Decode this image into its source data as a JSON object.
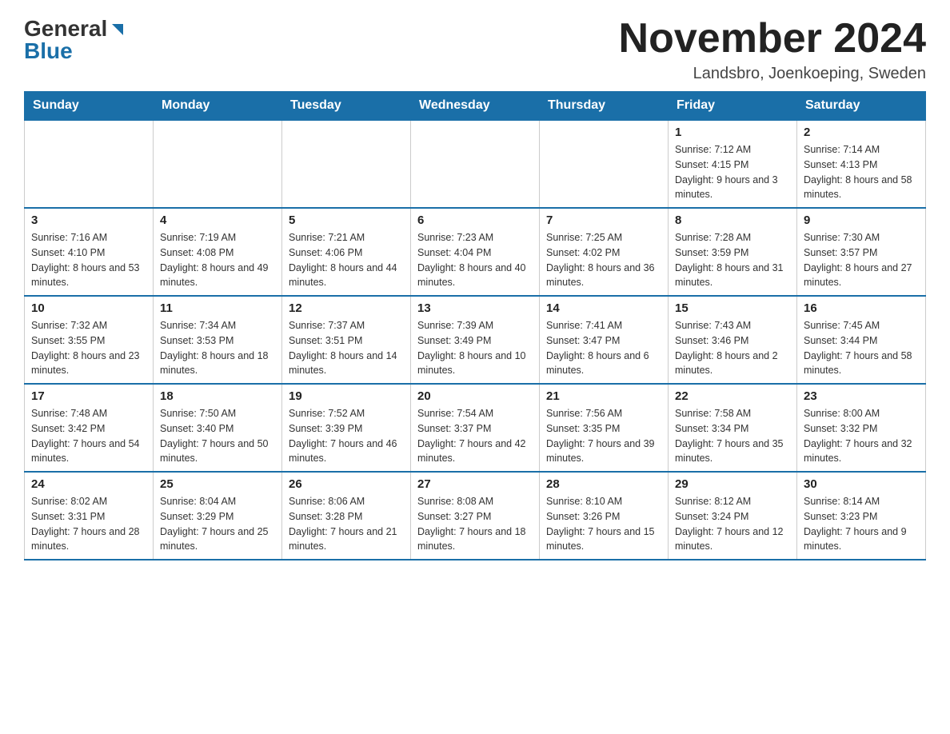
{
  "logo": {
    "general": "General",
    "blue": "Blue"
  },
  "title": "November 2024",
  "location": "Landsbro, Joenkoeping, Sweden",
  "days_of_week": [
    "Sunday",
    "Monday",
    "Tuesday",
    "Wednesday",
    "Thursday",
    "Friday",
    "Saturday"
  ],
  "weeks": [
    [
      {
        "day": "",
        "info": ""
      },
      {
        "day": "",
        "info": ""
      },
      {
        "day": "",
        "info": ""
      },
      {
        "day": "",
        "info": ""
      },
      {
        "day": "",
        "info": ""
      },
      {
        "day": "1",
        "info": "Sunrise: 7:12 AM\nSunset: 4:15 PM\nDaylight: 9 hours and 3 minutes."
      },
      {
        "day": "2",
        "info": "Sunrise: 7:14 AM\nSunset: 4:13 PM\nDaylight: 8 hours and 58 minutes."
      }
    ],
    [
      {
        "day": "3",
        "info": "Sunrise: 7:16 AM\nSunset: 4:10 PM\nDaylight: 8 hours and 53 minutes."
      },
      {
        "day": "4",
        "info": "Sunrise: 7:19 AM\nSunset: 4:08 PM\nDaylight: 8 hours and 49 minutes."
      },
      {
        "day": "5",
        "info": "Sunrise: 7:21 AM\nSunset: 4:06 PM\nDaylight: 8 hours and 44 minutes."
      },
      {
        "day": "6",
        "info": "Sunrise: 7:23 AM\nSunset: 4:04 PM\nDaylight: 8 hours and 40 minutes."
      },
      {
        "day": "7",
        "info": "Sunrise: 7:25 AM\nSunset: 4:02 PM\nDaylight: 8 hours and 36 minutes."
      },
      {
        "day": "8",
        "info": "Sunrise: 7:28 AM\nSunset: 3:59 PM\nDaylight: 8 hours and 31 minutes."
      },
      {
        "day": "9",
        "info": "Sunrise: 7:30 AM\nSunset: 3:57 PM\nDaylight: 8 hours and 27 minutes."
      }
    ],
    [
      {
        "day": "10",
        "info": "Sunrise: 7:32 AM\nSunset: 3:55 PM\nDaylight: 8 hours and 23 minutes."
      },
      {
        "day": "11",
        "info": "Sunrise: 7:34 AM\nSunset: 3:53 PM\nDaylight: 8 hours and 18 minutes."
      },
      {
        "day": "12",
        "info": "Sunrise: 7:37 AM\nSunset: 3:51 PM\nDaylight: 8 hours and 14 minutes."
      },
      {
        "day": "13",
        "info": "Sunrise: 7:39 AM\nSunset: 3:49 PM\nDaylight: 8 hours and 10 minutes."
      },
      {
        "day": "14",
        "info": "Sunrise: 7:41 AM\nSunset: 3:47 PM\nDaylight: 8 hours and 6 minutes."
      },
      {
        "day": "15",
        "info": "Sunrise: 7:43 AM\nSunset: 3:46 PM\nDaylight: 8 hours and 2 minutes."
      },
      {
        "day": "16",
        "info": "Sunrise: 7:45 AM\nSunset: 3:44 PM\nDaylight: 7 hours and 58 minutes."
      }
    ],
    [
      {
        "day": "17",
        "info": "Sunrise: 7:48 AM\nSunset: 3:42 PM\nDaylight: 7 hours and 54 minutes."
      },
      {
        "day": "18",
        "info": "Sunrise: 7:50 AM\nSunset: 3:40 PM\nDaylight: 7 hours and 50 minutes."
      },
      {
        "day": "19",
        "info": "Sunrise: 7:52 AM\nSunset: 3:39 PM\nDaylight: 7 hours and 46 minutes."
      },
      {
        "day": "20",
        "info": "Sunrise: 7:54 AM\nSunset: 3:37 PM\nDaylight: 7 hours and 42 minutes."
      },
      {
        "day": "21",
        "info": "Sunrise: 7:56 AM\nSunset: 3:35 PM\nDaylight: 7 hours and 39 minutes."
      },
      {
        "day": "22",
        "info": "Sunrise: 7:58 AM\nSunset: 3:34 PM\nDaylight: 7 hours and 35 minutes."
      },
      {
        "day": "23",
        "info": "Sunrise: 8:00 AM\nSunset: 3:32 PM\nDaylight: 7 hours and 32 minutes."
      }
    ],
    [
      {
        "day": "24",
        "info": "Sunrise: 8:02 AM\nSunset: 3:31 PM\nDaylight: 7 hours and 28 minutes."
      },
      {
        "day": "25",
        "info": "Sunrise: 8:04 AM\nSunset: 3:29 PM\nDaylight: 7 hours and 25 minutes."
      },
      {
        "day": "26",
        "info": "Sunrise: 8:06 AM\nSunset: 3:28 PM\nDaylight: 7 hours and 21 minutes."
      },
      {
        "day": "27",
        "info": "Sunrise: 8:08 AM\nSunset: 3:27 PM\nDaylight: 7 hours and 18 minutes."
      },
      {
        "day": "28",
        "info": "Sunrise: 8:10 AM\nSunset: 3:26 PM\nDaylight: 7 hours and 15 minutes."
      },
      {
        "day": "29",
        "info": "Sunrise: 8:12 AM\nSunset: 3:24 PM\nDaylight: 7 hours and 12 minutes."
      },
      {
        "day": "30",
        "info": "Sunrise: 8:14 AM\nSunset: 3:23 PM\nDaylight: 7 hours and 9 minutes."
      }
    ]
  ]
}
